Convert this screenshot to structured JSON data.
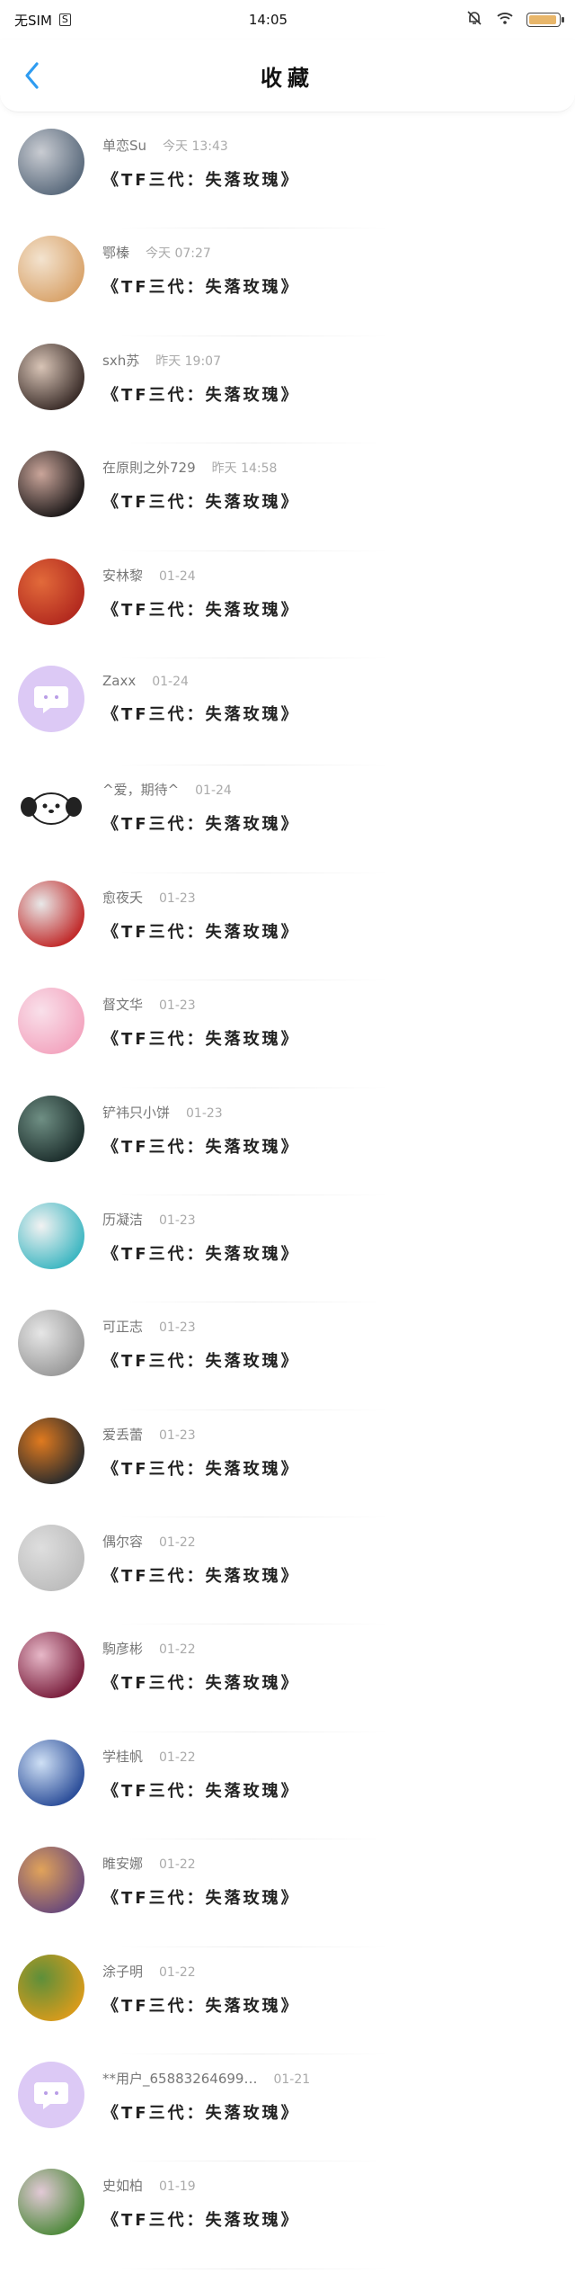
{
  "status_bar": {
    "carrier": "无SIM",
    "sim_badge": "S",
    "time": "14:05"
  },
  "colors": {
    "accent": "#2f9cf1",
    "battery": "#e8b66a"
  },
  "nav": {
    "title": "收藏",
    "back_icon": "chevron-left-icon"
  },
  "items": [
    {
      "name": "单恋Su",
      "time": "今天 13:43",
      "title": "《TF三代：失落玫瑰》",
      "avatar_colors": [
        "#5b6b7d",
        "#c9ccd2"
      ]
    },
    {
      "name": "鄂榛",
      "time": "今天 07:27",
      "title": "《TF三代：失落玫瑰》",
      "avatar_colors": [
        "#d9a46c",
        "#f3e3cf"
      ]
    },
    {
      "name": "sxh苏",
      "time": "昨天 19:07",
      "title": "《TF三代：失落玫瑰》",
      "avatar_colors": [
        "#3c2e2a",
        "#d8c4b6"
      ]
    },
    {
      "name": "在原則之外729",
      "time": "昨天 14:58",
      "title": "《TF三代：失落玫瑰》",
      "avatar_colors": [
        "#1e1a1a",
        "#caa59a"
      ]
    },
    {
      "name": "安林黎",
      "time": "01-24",
      "title": "《TF三代：失落玫瑰》",
      "avatar_colors": [
        "#b32a1f",
        "#e26a3a"
      ]
    },
    {
      "name": "Zaxx",
      "time": "01-24",
      "title": "《TF三代：失落玫瑰》",
      "avatar_colors": [
        "#dcc9f5",
        "#dcc9f5"
      ],
      "chat_icon": true
    },
    {
      "name": "^爱，期待^",
      "time": "01-24",
      "title": "《TF三代：失落玫瑰》",
      "avatar_colors": [
        "#ffffff",
        "#f0f0f0"
      ],
      "dog": true
    },
    {
      "name": "愈夜夭",
      "time": "01-23",
      "title": "《TF三代：失落玫瑰》",
      "avatar_colors": [
        "#c12b2b",
        "#e8e8e8"
      ]
    },
    {
      "name": "督文华",
      "time": "01-23",
      "title": "《TF三代：失落玫瑰》",
      "avatar_colors": [
        "#f3a6c0",
        "#f9e0ea"
      ]
    },
    {
      "name": "铲祎只小饼",
      "time": "01-23",
      "title": "《TF三代：失落玫瑰》",
      "avatar_colors": [
        "#1d2f2d",
        "#6f8f84"
      ]
    },
    {
      "name": "历凝洁",
      "time": "01-23",
      "title": "《TF三代：失落玫瑰》",
      "avatar_colors": [
        "#3fb7c2",
        "#f2f2f2"
      ]
    },
    {
      "name": "可正志",
      "time": "01-23",
      "title": "《TF三代：失落玫瑰》",
      "avatar_colors": [
        "#9a9a9a",
        "#e6e6e6"
      ]
    },
    {
      "name": "爱丢蕾",
      "time": "01-23",
      "title": "《TF三代：失落玫瑰》",
      "avatar_colors": [
        "#2c2c2c",
        "#e07a1f"
      ]
    },
    {
      "name": "偶尔容",
      "time": "01-22",
      "title": "《TF三代：失落玫瑰》",
      "avatar_colors": [
        "#bdbdbd",
        "#dedede"
      ]
    },
    {
      "name": "駒彦彬",
      "time": "01-22",
      "title": "《TF三代：失落玫瑰》",
      "avatar_colors": [
        "#7a1f3d",
        "#e7b8c8"
      ]
    },
    {
      "name": "学桂帆",
      "time": "01-22",
      "title": "《TF三代：失落玫瑰》",
      "avatar_colors": [
        "#2d4f9a",
        "#cfe0f5"
      ]
    },
    {
      "name": "睢安娜",
      "time": "01-22",
      "title": "《TF三代：失落玫瑰》",
      "avatar_colors": [
        "#6b4a7a",
        "#e1a35a"
      ]
    },
    {
      "name": "涂子明",
      "time": "01-22",
      "title": "《TF三代：失落玫瑰》",
      "avatar_colors": [
        "#d79b1c",
        "#5d8f3a"
      ]
    },
    {
      "name": "**用户_65883264699…",
      "time": "01-21",
      "title": "《TF三代：失落玫瑰》",
      "avatar_colors": [
        "#dcc9f5",
        "#dcc9f5"
      ],
      "chat_icon": true
    },
    {
      "name": "史如柏",
      "time": "01-19",
      "title": "《TF三代：失落玫瑰》",
      "avatar_colors": [
        "#4f8a3c",
        "#e2c9d6"
      ]
    }
  ]
}
